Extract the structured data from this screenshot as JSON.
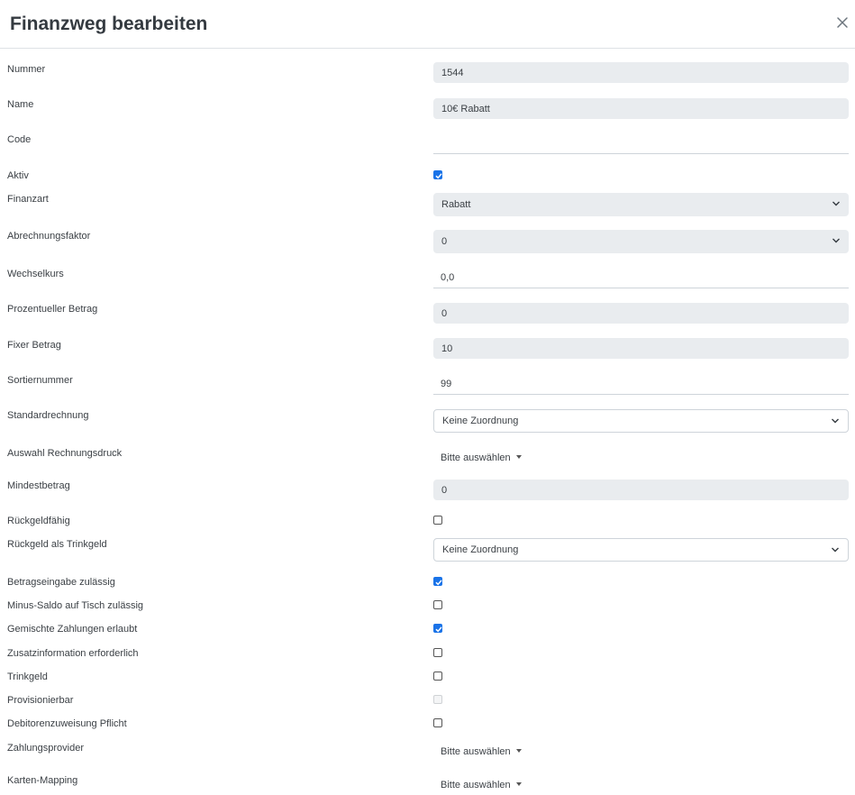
{
  "dialog": {
    "title": "Finanzweg bearbeiten",
    "close_icon": "close-icon"
  },
  "fields": {
    "nummer": {
      "label": "Nummer",
      "value": "1544"
    },
    "name": {
      "label": "Name",
      "value": "10€ Rabatt"
    },
    "code": {
      "label": "Code",
      "value": ""
    },
    "aktiv": {
      "label": "Aktiv",
      "checked": true
    },
    "finanzart": {
      "label": "Finanzart",
      "value": "Rabatt"
    },
    "abrechnungsfaktor": {
      "label": "Abrechnungsfaktor",
      "value": "0"
    },
    "wechselkurs": {
      "label": "Wechselkurs",
      "value": "0,0"
    },
    "prozentueller_betrag": {
      "label": "Prozentueller Betrag",
      "value": "0"
    },
    "fixer_betrag": {
      "label": "Fixer Betrag",
      "value": "10"
    },
    "sortiernummer": {
      "label": "Sortiernummer",
      "value": "99"
    },
    "standardrechnung": {
      "label": "Standardrechnung",
      "value": "Keine Zuordnung"
    },
    "auswahl_rechnungsdruck": {
      "label": "Auswahl Rechnungsdruck",
      "value": "Bitte auswählen"
    },
    "mindestbetrag": {
      "label": "Mindestbetrag",
      "value": "0"
    },
    "rueckgeldfaehig": {
      "label": "Rückgeldfähig",
      "checked": false
    },
    "rueckgeld_trinkgeld": {
      "label": "Rückgeld als Trinkgeld",
      "value": "Keine Zuordnung"
    },
    "betragseingabe": {
      "label": "Betragseingabe zulässig",
      "checked": true
    },
    "minus_saldo": {
      "label": "Minus-Saldo auf Tisch zulässig",
      "checked": false
    },
    "gemischte_zahlungen": {
      "label": "Gemischte Zahlungen erlaubt",
      "checked": true
    },
    "zusatzinformation": {
      "label": "Zusatzinformation erforderlich",
      "checked": false
    },
    "trinkgeld": {
      "label": "Trinkgeld",
      "checked": false
    },
    "provisionierbar": {
      "label": "Provisionierbar",
      "checked": false,
      "disabled": true
    },
    "debitorenzuweisung": {
      "label": "Debitorenzuweisung Pflicht",
      "checked": false
    },
    "zahlungsprovider": {
      "label": "Zahlungsprovider",
      "value": "Bitte auswählen"
    },
    "karten_mapping": {
      "label": "Karten-Mapping",
      "value": "Bitte auswählen"
    }
  },
  "colors": {
    "checkbox_accent": "#1a73e8",
    "readonly_bg": "#e9ecef",
    "border": "#ced4da"
  }
}
